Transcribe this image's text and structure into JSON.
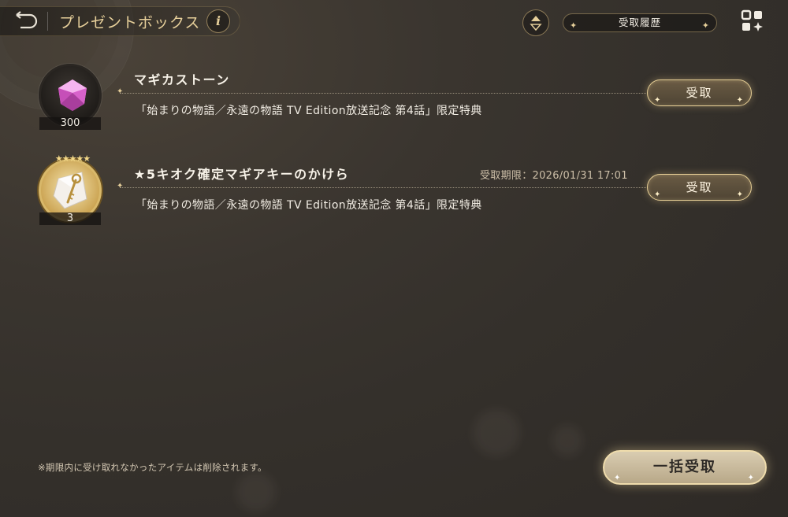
{
  "header": {
    "title": "プレゼントボックス",
    "info_label": "i",
    "history_label": "受取履歴"
  },
  "presents": [
    {
      "name": "マギカストーン",
      "count": "300",
      "deadline": "",
      "description": "「始まりの物語／永遠の物語 TV Edition放送記念 第4話」限定特典",
      "claim_label": "受取",
      "icon": "pink-gem-icon"
    },
    {
      "name": "★5キオク確定マギアキーのかけら",
      "count": "3",
      "deadline": "受取期限：2026/01/31 17:01",
      "description": "「始まりの物語／永遠の物語 TV Edition放送記念 第4話」限定特典",
      "claim_label": "受取",
      "icon": "magia-key-icon",
      "stars": "★★★★★"
    }
  ],
  "footer": {
    "note": "※期限内に受け取れなかったアイテムは削除されます。",
    "claim_all_label": "一括受取"
  },
  "colors": {
    "accent_gold": "#e6cf9a",
    "background": "#34302b",
    "gem_pink": "#e77ad9"
  }
}
